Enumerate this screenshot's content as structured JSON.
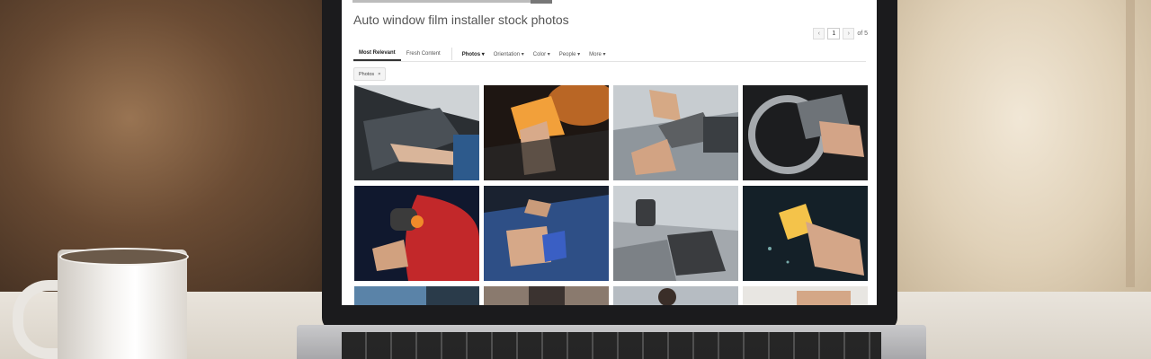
{
  "page": {
    "title": "Auto window film installer stock photos"
  },
  "pagination": {
    "prev_icon": "chevron-left-icon",
    "current_page": "1",
    "next_icon": "chevron-right-icon",
    "total_label": "of 5"
  },
  "filters": {
    "sort_tabs": [
      {
        "label": "Most Relevant",
        "active": true
      },
      {
        "label": "Fresh Content",
        "active": false
      }
    ],
    "dropdowns": [
      {
        "label": "Photos ▾"
      },
      {
        "label": "Orientation ▾"
      },
      {
        "label": "Color ▾"
      },
      {
        "label": "People ▾"
      },
      {
        "label": "More ▾"
      }
    ]
  },
  "active_chip": {
    "label": "Photos",
    "remove": "×"
  },
  "thumbnails": [
    {
      "subject": "car-window-tinting"
    },
    {
      "subject": "squeegee-on-glass"
    },
    {
      "subject": "cutting-film"
    },
    {
      "subject": "steering-wheel-window"
    },
    {
      "subject": "heat-gun-car"
    },
    {
      "subject": "blue-car-squeegee"
    },
    {
      "subject": "heat-gun-rear-window"
    },
    {
      "subject": "yellow-squeegee-glass"
    },
    {
      "subject": "partial-photo"
    },
    {
      "subject": "partial-photo"
    },
    {
      "subject": "partial-photo"
    },
    {
      "subject": "partial-photo"
    }
  ],
  "colors": {
    "screen_bg": "#ffffff",
    "title_text": "#555555",
    "squeegee_orange": "#f2a03a",
    "squeegee_yellow": "#f4c34a",
    "squeegee_blue": "#3a5fc4"
  }
}
